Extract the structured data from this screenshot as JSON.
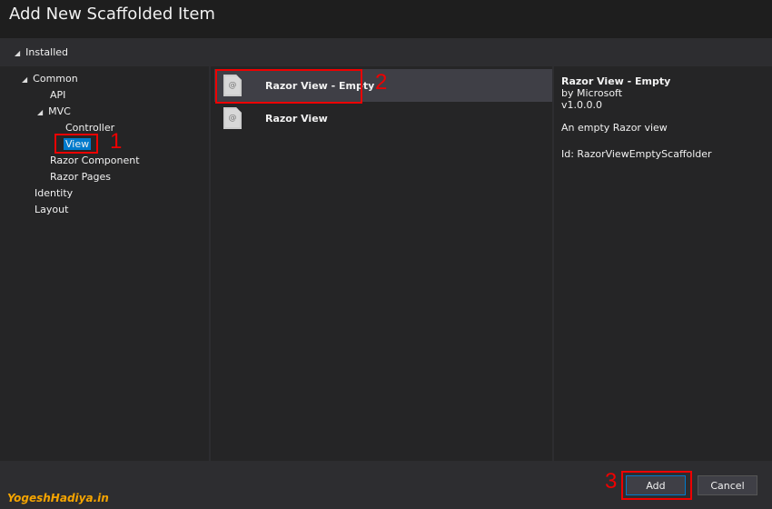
{
  "window": {
    "title": "Add New Scaffolded Item"
  },
  "tree": {
    "root": "Installed",
    "items": [
      {
        "label": "Common",
        "expanded": true
      },
      {
        "label": "API"
      },
      {
        "label": "MVC",
        "expanded": true
      },
      {
        "label": "Controller"
      },
      {
        "label": "View",
        "selected": true
      },
      {
        "label": "Razor Component"
      },
      {
        "label": "Razor Pages"
      },
      {
        "label": "Identity"
      },
      {
        "label": "Layout"
      }
    ]
  },
  "templates": [
    {
      "label": "Razor View - Empty",
      "selected": true,
      "icon": "razor-file-icon",
      "glyph": "@"
    },
    {
      "label": "Razor View",
      "icon": "razor-file-icon",
      "glyph": "@"
    }
  ],
  "details": {
    "name": "Razor View - Empty",
    "author": "by Microsoft",
    "version": "v1.0.0.0",
    "description": "An empty Razor view",
    "id": "Id: RazorViewEmptyScaffolder"
  },
  "annotations": [
    "1",
    "2",
    "3"
  ],
  "buttons": {
    "add": "Add",
    "cancel": "Cancel"
  },
  "watermark": "YogeshHadiya.in",
  "colors": {
    "accent": "#007acc",
    "annotation": "#e00000"
  }
}
